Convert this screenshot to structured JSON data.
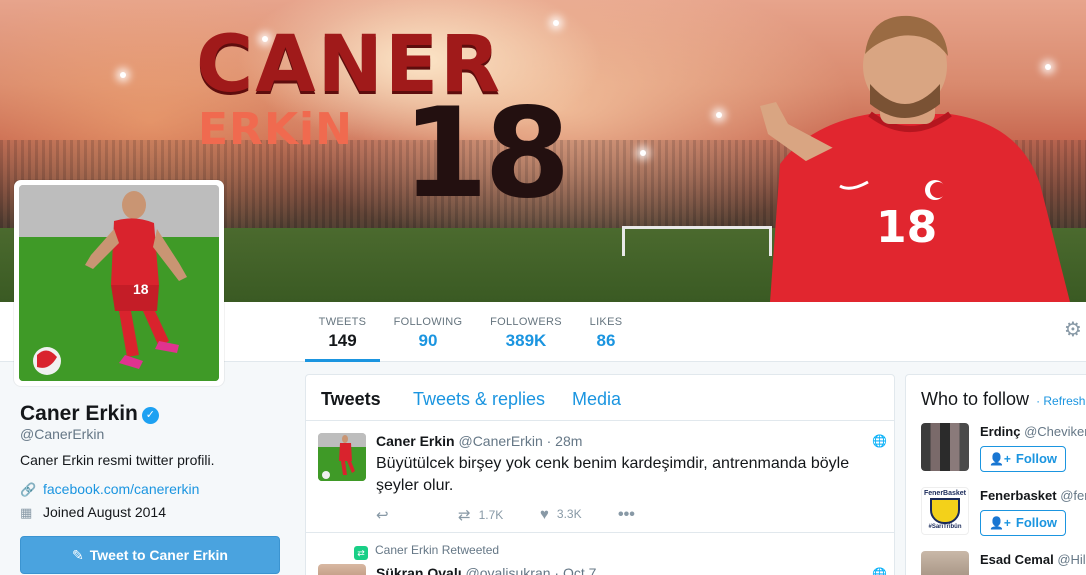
{
  "banner": {
    "word1": "CANER",
    "word2": "ERKiN",
    "number": "18",
    "jersey_number": "18"
  },
  "avatar": {
    "jersey_number": "18"
  },
  "nav": {
    "items": [
      {
        "label": "TWEETS",
        "value": "149"
      },
      {
        "label": "FOLLOWING",
        "value": "90"
      },
      {
        "label": "FOLLOWERS",
        "value": "389K"
      },
      {
        "label": "LIKES",
        "value": "86"
      }
    ],
    "settings_icon": "gear-icon"
  },
  "profile": {
    "name": "Caner Erkin",
    "verified_mark": "✓",
    "handle": "@CanerErkin",
    "bio": "Caner Erkin resmi twitter profili.",
    "link": "facebook.com/canererkin",
    "joined": "Joined August 2014",
    "tweet_to_label": "Tweet to Caner Erkin"
  },
  "timeline": {
    "tabs": [
      "Tweets",
      "Tweets & replies",
      "Media"
    ],
    "tweet": {
      "name": "Caner Erkin",
      "handle": "@CanerErkin",
      "time": "· 28m",
      "text": "Büyütülcek birşey yok cenk benim kardeşimdir, antrenmanda böyle şeyler olur.",
      "retweets": "1.7K",
      "likes": "3.3K"
    },
    "retweet_label": "Caner Erkin Retweeted",
    "tweet2": {
      "name": "Şükran Ovalı",
      "handle": "@ovalisukran",
      "time": "· Oct 7"
    }
  },
  "who_to_follow": {
    "title": "Who to follow",
    "refresh": "· Refresh",
    "follow_label": "Follow",
    "suggestions": [
      {
        "name": "Erdinç",
        "handle": "@Cheviker"
      },
      {
        "name": "Fenerbasket",
        "handle": "@fen",
        "avatar_text_top": "FenerBasket",
        "avatar_text_bottom": "#SarıTribün"
      },
      {
        "name": "Esad Cemal",
        "handle": "@Hila"
      }
    ]
  },
  "colors": {
    "accent": "#1b95e0",
    "verified": "#1da1f2",
    "retweet": "#19cf86"
  }
}
